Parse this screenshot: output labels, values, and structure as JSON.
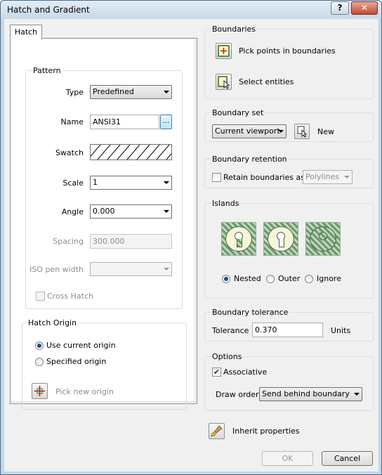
{
  "window": {
    "title": "Hatch and Gradient",
    "help_glyph": "?",
    "close_glyph": "✕"
  },
  "tabs": [
    {
      "label": "Hatch"
    }
  ],
  "pattern": {
    "title": "Pattern",
    "type_label": "Type",
    "type_value": "Predefined",
    "name_label": "Name",
    "name_value": "ANSI31",
    "browse_glyph": "...",
    "swatch_label": "Swatch",
    "scale_label": "Scale",
    "scale_value": "1",
    "angle_label": "Angle",
    "angle_value": "0.000",
    "spacing_label": "Spacing",
    "spacing_value": "300.000",
    "iso_label": "ISO pen width",
    "iso_value": "",
    "crosshatch_label": "Cross Hatch",
    "crosshatch_checked": false
  },
  "hatch_origin": {
    "title": "Hatch Origin",
    "use_current_label": "Use current origin",
    "specified_label": "Specified origin",
    "selected": "use_current",
    "pick_label": "Pick new origin"
  },
  "boundaries": {
    "title": "Boundaries",
    "pick_points_label": "Pick points in boundaries",
    "select_entities_label": "Select entities"
  },
  "boundary_set": {
    "title": "Boundary set",
    "value": "Current viewport",
    "new_label": "New"
  },
  "boundary_retention": {
    "title": "Boundary retention",
    "retain_label": "Retain boundaries as",
    "retain_checked": false,
    "type_value": "Polylines"
  },
  "islands": {
    "title": "Islands",
    "options": [
      {
        "label": "Nested",
        "selected": true
      },
      {
        "label": "Outer",
        "selected": false
      },
      {
        "label": "Ignore",
        "selected": false
      }
    ]
  },
  "boundary_tolerance": {
    "title": "Boundary tolerance",
    "label": "Tolerance",
    "value": "0.370",
    "units": "Units"
  },
  "options": {
    "title": "Options",
    "associative_label": "Associative",
    "associative_checked": true,
    "check_glyph": "✔",
    "draw_order_label": "Draw order",
    "draw_order_value": "Send behind boundary"
  },
  "inherit_label": "Inherit properties",
  "buttons": {
    "ok": "OK",
    "cancel": "Cancel"
  },
  "colors": {
    "title_bar": "#c7d8e8",
    "close_button": "#c34a32",
    "radio_dot": "#1c4a8a",
    "hatch_green": "#6a9b6a"
  }
}
